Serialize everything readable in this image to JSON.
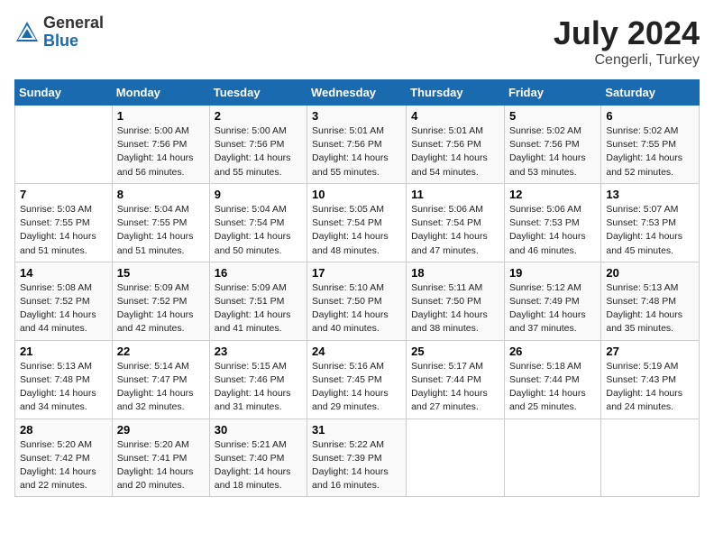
{
  "header": {
    "logo_general": "General",
    "logo_blue": "Blue",
    "month": "July 2024",
    "location": "Cengerli, Turkey"
  },
  "weekdays": [
    "Sunday",
    "Monday",
    "Tuesday",
    "Wednesday",
    "Thursday",
    "Friday",
    "Saturday"
  ],
  "weeks": [
    [
      {
        "day": "",
        "info": ""
      },
      {
        "day": "1",
        "info": "Sunrise: 5:00 AM\nSunset: 7:56 PM\nDaylight: 14 hours\nand 56 minutes."
      },
      {
        "day": "2",
        "info": "Sunrise: 5:00 AM\nSunset: 7:56 PM\nDaylight: 14 hours\nand 55 minutes."
      },
      {
        "day": "3",
        "info": "Sunrise: 5:01 AM\nSunset: 7:56 PM\nDaylight: 14 hours\nand 55 minutes."
      },
      {
        "day": "4",
        "info": "Sunrise: 5:01 AM\nSunset: 7:56 PM\nDaylight: 14 hours\nand 54 minutes."
      },
      {
        "day": "5",
        "info": "Sunrise: 5:02 AM\nSunset: 7:56 PM\nDaylight: 14 hours\nand 53 minutes."
      },
      {
        "day": "6",
        "info": "Sunrise: 5:02 AM\nSunset: 7:55 PM\nDaylight: 14 hours\nand 52 minutes."
      }
    ],
    [
      {
        "day": "7",
        "info": "Sunrise: 5:03 AM\nSunset: 7:55 PM\nDaylight: 14 hours\nand 51 minutes."
      },
      {
        "day": "8",
        "info": "Sunrise: 5:04 AM\nSunset: 7:55 PM\nDaylight: 14 hours\nand 51 minutes."
      },
      {
        "day": "9",
        "info": "Sunrise: 5:04 AM\nSunset: 7:54 PM\nDaylight: 14 hours\nand 50 minutes."
      },
      {
        "day": "10",
        "info": "Sunrise: 5:05 AM\nSunset: 7:54 PM\nDaylight: 14 hours\nand 48 minutes."
      },
      {
        "day": "11",
        "info": "Sunrise: 5:06 AM\nSunset: 7:54 PM\nDaylight: 14 hours\nand 47 minutes."
      },
      {
        "day": "12",
        "info": "Sunrise: 5:06 AM\nSunset: 7:53 PM\nDaylight: 14 hours\nand 46 minutes."
      },
      {
        "day": "13",
        "info": "Sunrise: 5:07 AM\nSunset: 7:53 PM\nDaylight: 14 hours\nand 45 minutes."
      }
    ],
    [
      {
        "day": "14",
        "info": "Sunrise: 5:08 AM\nSunset: 7:52 PM\nDaylight: 14 hours\nand 44 minutes."
      },
      {
        "day": "15",
        "info": "Sunrise: 5:09 AM\nSunset: 7:52 PM\nDaylight: 14 hours\nand 42 minutes."
      },
      {
        "day": "16",
        "info": "Sunrise: 5:09 AM\nSunset: 7:51 PM\nDaylight: 14 hours\nand 41 minutes."
      },
      {
        "day": "17",
        "info": "Sunrise: 5:10 AM\nSunset: 7:50 PM\nDaylight: 14 hours\nand 40 minutes."
      },
      {
        "day": "18",
        "info": "Sunrise: 5:11 AM\nSunset: 7:50 PM\nDaylight: 14 hours\nand 38 minutes."
      },
      {
        "day": "19",
        "info": "Sunrise: 5:12 AM\nSunset: 7:49 PM\nDaylight: 14 hours\nand 37 minutes."
      },
      {
        "day": "20",
        "info": "Sunrise: 5:13 AM\nSunset: 7:48 PM\nDaylight: 14 hours\nand 35 minutes."
      }
    ],
    [
      {
        "day": "21",
        "info": "Sunrise: 5:13 AM\nSunset: 7:48 PM\nDaylight: 14 hours\nand 34 minutes."
      },
      {
        "day": "22",
        "info": "Sunrise: 5:14 AM\nSunset: 7:47 PM\nDaylight: 14 hours\nand 32 minutes."
      },
      {
        "day": "23",
        "info": "Sunrise: 5:15 AM\nSunset: 7:46 PM\nDaylight: 14 hours\nand 31 minutes."
      },
      {
        "day": "24",
        "info": "Sunrise: 5:16 AM\nSunset: 7:45 PM\nDaylight: 14 hours\nand 29 minutes."
      },
      {
        "day": "25",
        "info": "Sunrise: 5:17 AM\nSunset: 7:44 PM\nDaylight: 14 hours\nand 27 minutes."
      },
      {
        "day": "26",
        "info": "Sunrise: 5:18 AM\nSunset: 7:44 PM\nDaylight: 14 hours\nand 25 minutes."
      },
      {
        "day": "27",
        "info": "Sunrise: 5:19 AM\nSunset: 7:43 PM\nDaylight: 14 hours\nand 24 minutes."
      }
    ],
    [
      {
        "day": "28",
        "info": "Sunrise: 5:20 AM\nSunset: 7:42 PM\nDaylight: 14 hours\nand 22 minutes."
      },
      {
        "day": "29",
        "info": "Sunrise: 5:20 AM\nSunset: 7:41 PM\nDaylight: 14 hours\nand 20 minutes."
      },
      {
        "day": "30",
        "info": "Sunrise: 5:21 AM\nSunset: 7:40 PM\nDaylight: 14 hours\nand 18 minutes."
      },
      {
        "day": "31",
        "info": "Sunrise: 5:22 AM\nSunset: 7:39 PM\nDaylight: 14 hours\nand 16 minutes."
      },
      {
        "day": "",
        "info": ""
      },
      {
        "day": "",
        "info": ""
      },
      {
        "day": "",
        "info": ""
      }
    ]
  ]
}
